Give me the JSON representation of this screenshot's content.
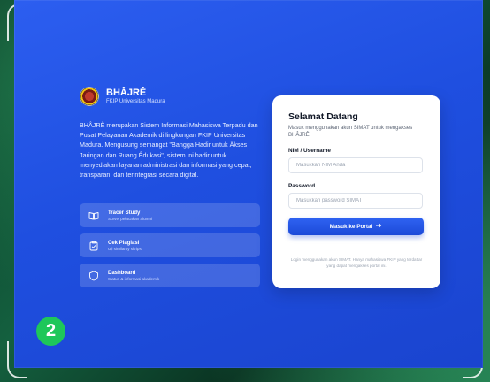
{
  "brand": {
    "name": "BHÂJRÊ",
    "subtitle": "FKIP Universitas Madura"
  },
  "description": "BHÂJRÊ merupakan Sistem Informasi Mahasiswa Terpadu dan Pusat Pelayanan Akademik di lingkungan FKIP Universitas Madura. Mengusung semangat \"Bangga Hadir untuk Âkses Jaringan dan Ruang Êdukasi\", sistem ini hadir untuk menyediakan layanan administrasi dan informasi yang cepat, transparan, dan terintegrasi secara digital.",
  "features": [
    {
      "title": "Tracer Study",
      "subtitle": "Survei pelacakan alumni",
      "icon": "book-icon"
    },
    {
      "title": "Cek Plagiasi",
      "subtitle": "Uji similarity skripsi",
      "icon": "clipboard-check-icon"
    },
    {
      "title": "Dashboard",
      "subtitle": "Status & informasi akademik",
      "icon": "shield-icon"
    }
  ],
  "login": {
    "title": "Selamat Datang",
    "subtitle": "Masuk menggunakan akun SIMAT untuk mengakses BHÂJRÊ.",
    "nim_label": "NIM / Username",
    "nim_placeholder": "Masukkan NIM Anda",
    "nim_value": "",
    "password_label": "Password",
    "password_placeholder": "Masukkan password SIMAT",
    "password_value": "",
    "submit_label": "Masuk ke Portal",
    "submit_icon": "arrow-right-icon",
    "note": "Login menggunakan akun SIMAT. Hanya mahasiswa FKIP yang terdaftar yang dapat mengakses portal ini."
  },
  "badge": {
    "number": "2",
    "color": "#1ec75a"
  },
  "colors": {
    "panel": "#2356e8",
    "accent": "#1c4ad8"
  }
}
